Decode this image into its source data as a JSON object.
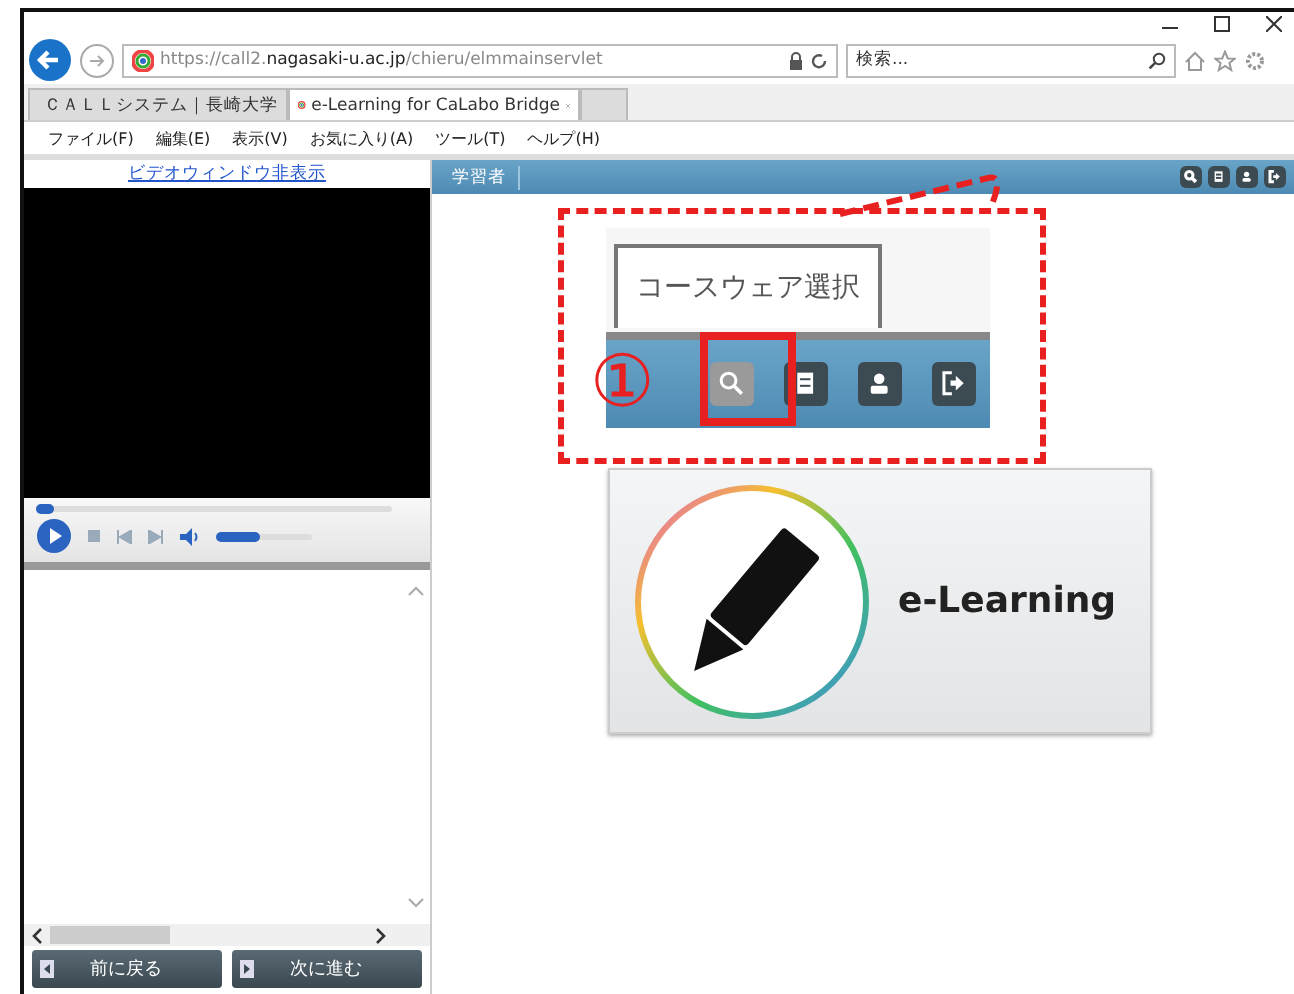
{
  "browser": {
    "url": "https://call2.**nagasaki-u.ac.jp**/chieru/elmmainservlet",
    "search": {
      "placeholder": "検索..."
    }
  },
  "tabs": [
    {
      "label": "ＣＡＬＬシステム｜長崎大学",
      "selected": false
    },
    {
      "label": "e-Learning for CaLabo Bridge",
      "selected": true
    }
  ],
  "menu": [
    "ファイル(F)",
    "編集(E)",
    "表示(V)",
    "お気に入り(A)",
    "ツール(T)",
    "ヘルプ(H)"
  ],
  "left_panel": {
    "video_link": "ビデオウィンドウ非表示",
    "seek": {
      "level": 0.04
    },
    "volume": {
      "level": 0.45
    },
    "nav_buttons": [
      "前に戻る",
      "次に進む"
    ]
  },
  "header": {
    "user_label": "学習者"
  },
  "callout": {
    "tab_label": "コースウェア選択",
    "step": "①"
  },
  "card": {
    "label": "e-Learning"
  }
}
